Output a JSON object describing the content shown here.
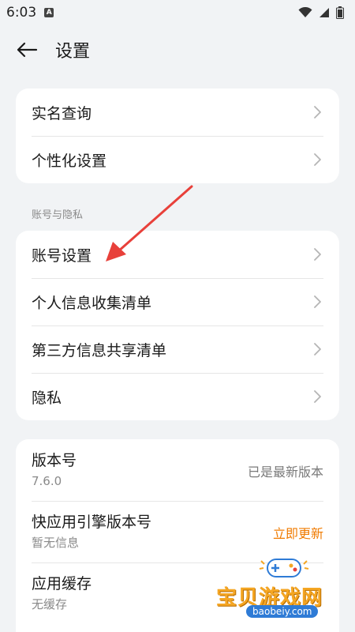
{
  "status_bar": {
    "time": "6:03",
    "indicator": "A"
  },
  "header": {
    "title": "设置"
  },
  "card1": {
    "items": [
      {
        "label": "实名查询"
      },
      {
        "label": "个性化设置"
      }
    ]
  },
  "section2": {
    "label": "账号与隐私",
    "items": [
      {
        "label": "账号设置"
      },
      {
        "label": "个人信息收集清单"
      },
      {
        "label": "第三方信息共享清单"
      },
      {
        "label": "隐私"
      }
    ]
  },
  "info_card": {
    "items": [
      {
        "title": "版本号",
        "subtitle": "7.6.0",
        "right": "已是最新版本"
      },
      {
        "title": "快应用引擎版本号",
        "subtitle": "暂无信息",
        "right": "立即更新"
      },
      {
        "title": "应用缓存",
        "subtitle": "无缓存"
      }
    ]
  },
  "watermark": {
    "text": "宝贝游戏网",
    "url": "baobeiy.com"
  },
  "colors": {
    "accent_orange": "#f07b00",
    "annotation_red": "#e8403a",
    "background": "#f1f3f5"
  }
}
